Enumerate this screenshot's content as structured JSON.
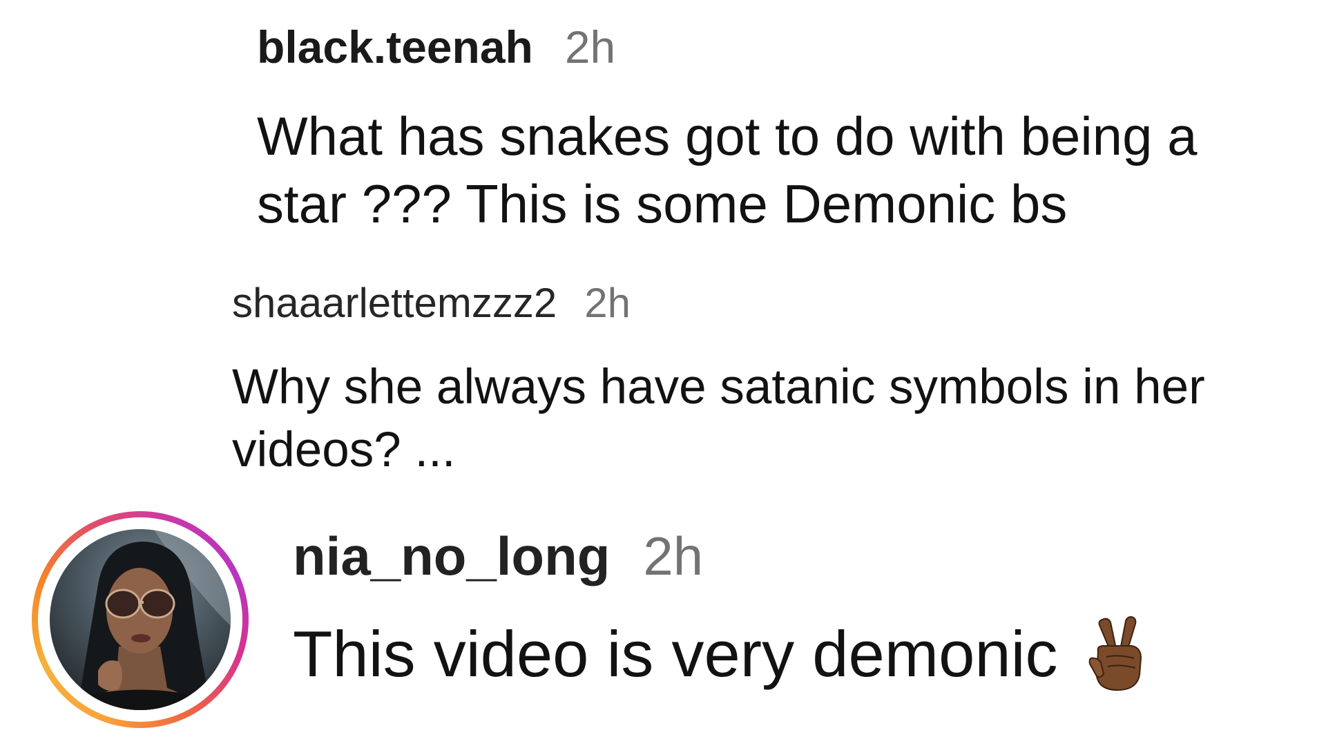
{
  "comments": [
    {
      "username": "black.teenah",
      "time": "2h",
      "text": "What has snakes got to do with being a star ??? This is some Demonic bs"
    },
    {
      "username": "shaaarlettemzzz2",
      "time": "2h",
      "text": "Why she always have satanic symbols in her videos? ..."
    },
    {
      "username": "nia_no_long",
      "time": "2h",
      "text": "This video is very demonic",
      "emoji": "victory-hand-emoji",
      "has_story_ring": true
    }
  ],
  "colors": {
    "username": "#1a1a1a",
    "timestamp": "#737373",
    "story_ring_start": "#f9a23a",
    "story_ring_end": "#c837ab"
  }
}
